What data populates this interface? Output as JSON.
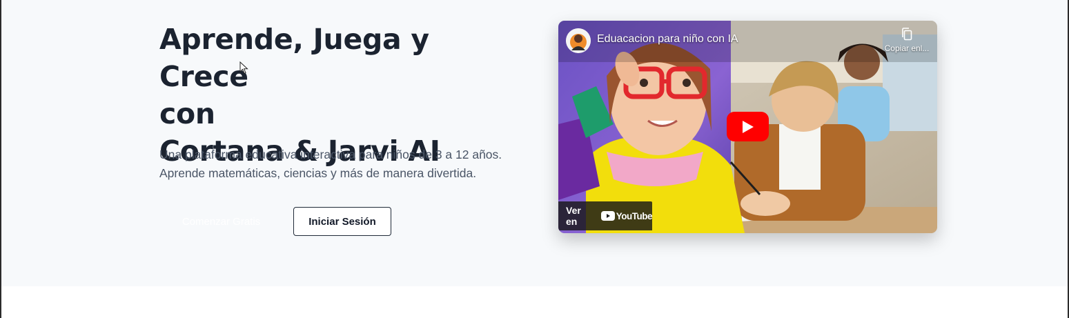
{
  "hero": {
    "headline_lines": [
      "Aprende, Juega y Crece",
      "con",
      "Cortana & Jarvi AI"
    ],
    "subtitle_lines": [
      "Una plataforma educativa interactiva para niños de 3 a 12 años.",
      "Aprende matemáticas, ciencias y más de manera divertida."
    ],
    "primary_button": "Comenzar Gratis",
    "secondary_button": "Iniciar Sesión"
  },
  "video": {
    "title": "Eduacacion para niño con IA",
    "copy_link_label": "Copiar enl...",
    "watch_on_label": "Ver en",
    "platform_name": "YouTube",
    "colors": {
      "play_button": "#ff0000"
    }
  },
  "colors": {
    "hero_background": "#f7f9fb",
    "headline": "#1b2330",
    "subtitle": "#4a5566"
  }
}
